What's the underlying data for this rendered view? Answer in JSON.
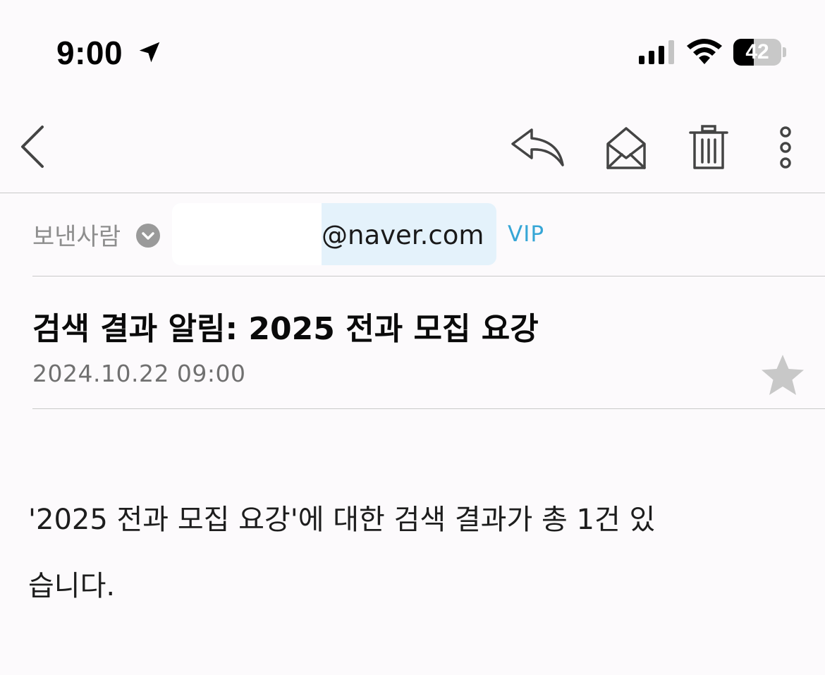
{
  "status_bar": {
    "time": "9:00",
    "battery_level": "42",
    "battery_fraction": 0.42
  },
  "toolbar": {
    "icons": [
      "chevron-left-icon",
      "reply-icon",
      "open-envelope-icon",
      "trash-icon",
      "more-vertical-icon"
    ]
  },
  "sender": {
    "label": "보낸사람",
    "email": "@naver.com",
    "badge": "VIP"
  },
  "mail": {
    "subject": "검색 결과 알림: 2025 전과 모집 요강",
    "date": "2024.10.22 09:00",
    "starred": false,
    "body_lines": [
      "'2025 전과 모집 요강'에 대한 검색 결과가 총 1건 있",
      "습니다."
    ]
  },
  "colors": {
    "background": "#fcfafc",
    "accent": "#36a6d6",
    "chip_background": "#e4f2fb",
    "icon": "#444444",
    "star": "#c8c8c8"
  }
}
